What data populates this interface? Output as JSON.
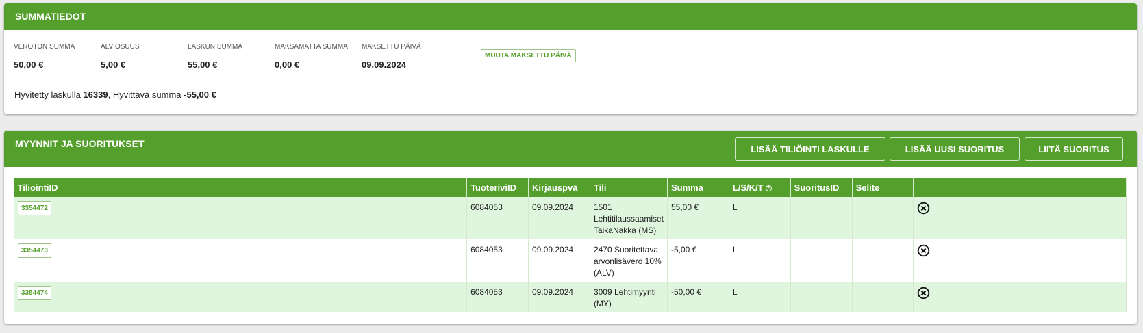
{
  "summary": {
    "title": "SUMMATIEDOT",
    "items": [
      {
        "label": "VEROTON SUMMA",
        "value": "50,00 €"
      },
      {
        "label": "ALV OSUUS",
        "value": "5,00 €"
      },
      {
        "label": "LASKUN SUMMA",
        "value": "55,00 €"
      },
      {
        "label": "MAKSAMATTA SUMMA",
        "value": "0,00 €"
      },
      {
        "label": "MAKSETTU PÄIVÄ",
        "value": "09.09.2024"
      }
    ],
    "change_paid_date_label": "MUUTA MAKSETTU PÄIVÄ",
    "credit": {
      "prefix": "Hyvitetty laskulla",
      "invoice": "16339",
      "middle": ", Hyvittävä summa",
      "amount": "-55,00 €"
    }
  },
  "sales": {
    "title": "MYYNNIT JA SUORITUKSET",
    "buttons": {
      "add_entry": "LISÄÄ TILIÖINTI LASKULLE",
      "add_payment": "LISÄÄ UUSI SUORITUS",
      "attach_payment": "LIITÄ SUORITUS"
    },
    "columns": [
      "TiliointiID",
      "TuoteriviID",
      "Kirjauspvä",
      "Tili",
      "Summa",
      "L/S/K/T",
      "SuoritusID",
      "Selite",
      ""
    ],
    "rows": [
      {
        "id": "3354472",
        "tuoterivi": "6084053",
        "date": "09.09.2024",
        "tili": "1501 Lehtitilaussaamiset TaikaNakka (MS)",
        "summa": "55,00 €",
        "lskt": "L",
        "suoritus": "",
        "selite": ""
      },
      {
        "id": "3354473",
        "tuoterivi": "6084053",
        "date": "09.09.2024",
        "tili": "2470 Suoritettava arvonlisävero 10% (ALV)",
        "summa": "-5,00 €",
        "lskt": "L",
        "suoritus": "",
        "selite": ""
      },
      {
        "id": "3354474",
        "tuoterivi": "6084053",
        "date": "09.09.2024",
        "tili": "3009 Lehtimyynti (MY)",
        "summa": "-50,00 €",
        "lskt": "L",
        "suoritus": "",
        "selite": ""
      }
    ]
  },
  "icons": {
    "help": "help-circle-icon",
    "delete": "close-circle-icon"
  },
  "colors": {
    "accent": "#55a02d",
    "row_alt": "#dff5dd"
  }
}
